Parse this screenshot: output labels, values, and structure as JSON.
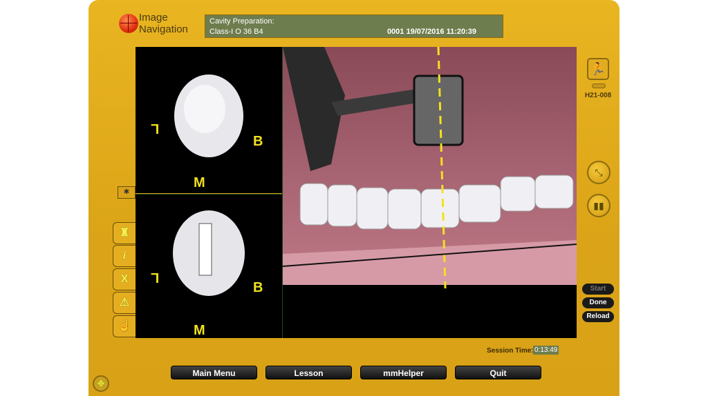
{
  "logo": {
    "line1": "Image",
    "line2": "Navigation"
  },
  "info": {
    "title": "Cavity Preparation:",
    "subtitle": "Class-I O 36 B4",
    "timestamp": "0001 19/07/2016 11:20:39"
  },
  "views": {
    "top_labels": {
      "left": "L",
      "right": "B",
      "bottom": "M"
    },
    "bottom_labels": {
      "left": "L",
      "right": "B",
      "bottom": "M"
    }
  },
  "right_panel": {
    "station_id": "H21-008",
    "buttons": {
      "start": "Start",
      "done": "Done",
      "reload": "Reload"
    }
  },
  "left_tabs": [
    "tooth-icon",
    "info-icon",
    "close-icon",
    "warning-icon",
    "pointer-hand-icon"
  ],
  "left_tab_glyphs": [
    "♜",
    "i",
    "X",
    "⚠",
    "☝"
  ],
  "session": {
    "label": "Session Time:",
    "value": "0:13:49"
  },
  "bottom_buttons": {
    "main_menu": "Main Menu",
    "lesson": "Lesson",
    "mmhelper": "mmHelper",
    "quit": "Quit"
  }
}
